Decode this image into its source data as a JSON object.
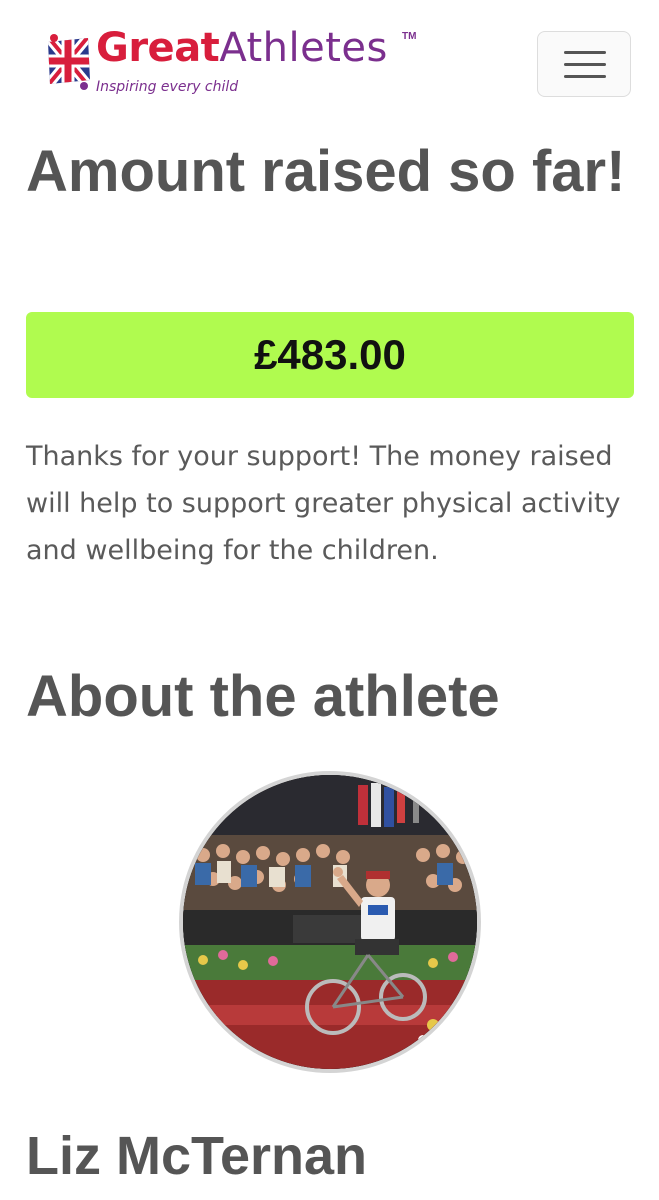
{
  "header": {
    "logo": {
      "brand_primary": "Great",
      "brand_secondary": "Athletes",
      "trademark": "TM",
      "tagline": "Inspiring every child",
      "colors": {
        "red": "#d81e3c",
        "purple": "#7b2f8e",
        "blue": "#2a3a8c"
      }
    },
    "menu_icon": "hamburger-icon"
  },
  "fundraising": {
    "heading": "Amount raised so far!",
    "amount": "£483.00",
    "amount_background": "#b0fb4f",
    "thanks_message": "Thanks for your support! The money raised will help to support greater physical activity and wellbeing for the children."
  },
  "about": {
    "heading": "About the athlete",
    "photo_icon": "athlete-photo",
    "athlete_name": "Liz McTernan"
  }
}
